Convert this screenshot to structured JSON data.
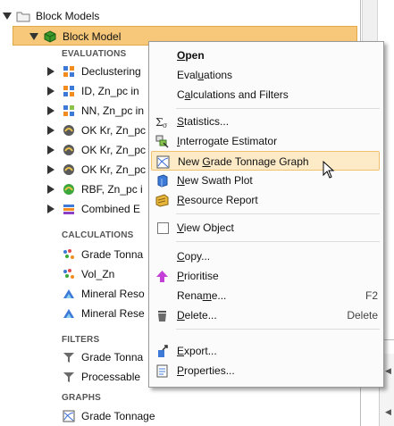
{
  "tree": {
    "root": "Block Models",
    "model": "Block Model",
    "sections": {
      "evaluations": "EVALUATIONS",
      "calculations": "CALCULATIONS",
      "filters": "FILTERS",
      "graphs": "GRAPHS"
    },
    "evaluations": [
      "Declustering",
      "ID, Zn_pc in",
      "NN, Zn_pc in",
      "OK Kr, Zn_pc",
      "OK Kr, Zn_pc",
      "OK Kr, Zn_pc",
      "RBF, Zn_pc i",
      "Combined E"
    ],
    "calculations": [
      "Grade Tonna",
      "Vol_Zn",
      "Mineral Reso",
      "Mineral Rese"
    ],
    "filters": [
      "Grade Tonna",
      "Processable"
    ],
    "graphs": [
      "Grade Tonnage"
    ]
  },
  "menu": {
    "items": [
      {
        "pre": "",
        "u": "O",
        "post": "pen",
        "shortcut": ""
      },
      {
        "pre": "Eval",
        "u": "u",
        "post": "ations",
        "shortcut": ""
      },
      {
        "pre": "C",
        "u": "a",
        "post": "lculations and Filters",
        "shortcut": ""
      },
      {
        "pre": "",
        "u": "S",
        "post": "tatistics...",
        "shortcut": ""
      },
      {
        "pre": "",
        "u": "I",
        "post": "nterrogate Estimator",
        "shortcut": ""
      },
      {
        "pre": "New ",
        "u": "G",
        "post": "rade Tonnage Graph",
        "shortcut": ""
      },
      {
        "pre": "",
        "u": "N",
        "post": "ew Swath Plot",
        "shortcut": ""
      },
      {
        "pre": "",
        "u": "R",
        "post": "esource Report",
        "shortcut": ""
      },
      {
        "pre": "",
        "u": "V",
        "post": "iew Object",
        "shortcut": ""
      },
      {
        "pre": "",
        "u": "C",
        "post": "opy...",
        "shortcut": ""
      },
      {
        "pre": "",
        "u": "P",
        "post": "rioritise",
        "shortcut": ""
      },
      {
        "pre": "Rena",
        "u": "m",
        "post": "e...",
        "shortcut": "F2"
      },
      {
        "pre": "",
        "u": "D",
        "post": "elete...",
        "shortcut": "Delete"
      },
      {
        "pre": "",
        "u": "E",
        "post": "xport...",
        "shortcut": ""
      },
      {
        "pre": "",
        "u": "P",
        "post": "roperties...",
        "shortcut": ""
      }
    ]
  },
  "colors": {
    "selection": "#f7c77a",
    "menu_highlight": "#fdebc8",
    "folder": "#d8b75e"
  }
}
